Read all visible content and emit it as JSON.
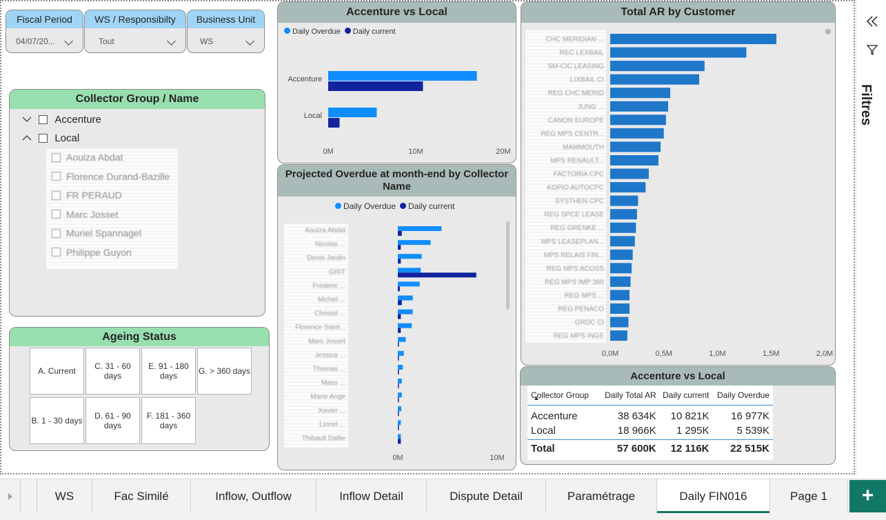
{
  "slicers": [
    {
      "title": "Fiscal Period",
      "value": "04/07/20..."
    },
    {
      "title": "WS / Responsibilty",
      "value": "Tout"
    },
    {
      "title": "Business Unit",
      "value": "WS"
    }
  ],
  "collector_group": {
    "title": "Collector Group / Name",
    "groups": [
      {
        "label": "Accenture",
        "expanded": false
      },
      {
        "label": "Local",
        "expanded": true
      }
    ],
    "children": [
      "Aouiza Abdat",
      "Florence Durand-Bazille",
      "FR PERAUD",
      "Marc Josset",
      "Muriel Spannagel",
      "Philippe Guyon"
    ]
  },
  "ageing_status": {
    "title": "Ageing Status",
    "items": [
      "A. Current",
      "C. 31 - 60 days",
      "E. 91 - 180 days",
      "G. > 360 days",
      "B. 1 - 30 days",
      "D. 61 - 90 days",
      "F. 181 - 360 days"
    ]
  },
  "accenture_vs_local_chart": {
    "title": "Accenture vs Local",
    "legend": [
      "Daily Overdue",
      "Daily current"
    ],
    "x_ticks": [
      "0M",
      "10M",
      "20M"
    ]
  },
  "projected_overdue_chart": {
    "title": "Projected Overdue at month-end by Collector Name",
    "legend": [
      "Daily Overdue",
      "Daily current"
    ],
    "x_ticks": [
      "0M",
      "10M"
    ],
    "names": [
      "Aouiza Abdat",
      "Nicolas ...",
      "Denis Jardin",
      "GRIT",
      "Frederic ...",
      "Michel ...",
      "Christel ...",
      "Florence Saint...",
      "Marc Josset",
      "Jessica ...",
      "Thomas ...",
      "Mass ...",
      "Marie Ange",
      "Xavier ...",
      "Lionel ...",
      "Thibault Dallie"
    ]
  },
  "total_ar_chart": {
    "title": "Total AR by Customer",
    "x_ticks": [
      "0,0M",
      "0,5M",
      "1,0M",
      "1,5M",
      "2,0M"
    ],
    "customers": [
      "CHC MERIDIAN ...",
      "REC LEXBAIL",
      "SM-CIC LEASING",
      "LIXBAIL CI",
      "REG CHC MERID",
      "JUNG ...",
      "CANON EUROPE",
      "REG MPS CENTR...",
      "MAMMOUTH",
      "MPS RENAULT...",
      "FACTORIA CPC",
      "KOPIO AUTOCPC",
      "SYSTHEN CPC",
      "REG SPCE LEASE",
      "REG GRENKE ...",
      "MPS LEASEPLAN...",
      "MPS RELAIS FIN...",
      "REG MPS ACOSS",
      "REG MPS IMP 360",
      "REG MPS ...",
      "REG PENACO",
      "GRDC CI",
      "REG MPS INGE"
    ]
  },
  "chart_data": [
    {
      "type": "bar",
      "title": "Accenture vs Local",
      "categories": [
        "Accenture",
        "Local"
      ],
      "series": [
        {
          "name": "Daily Overdue",
          "values": [
            16.977,
            5.539
          ]
        },
        {
          "name": "Daily current",
          "values": [
            10.821,
            1.295
          ]
        }
      ],
      "xlim": [
        0,
        20
      ],
      "unit": "M",
      "orientation": "horizontal",
      "colors": [
        "#118dff",
        "#12239e"
      ]
    },
    {
      "type": "bar",
      "title": "Projected Overdue at month-end by Collector Name",
      "orientation": "horizontal",
      "categories": [
        "Aouiza Abdat",
        "Nicolas ...",
        "Denis Jardin",
        "GRIT",
        "Frederic ...",
        "Michel ...",
        "Christel ...",
        "Florence Saint...",
        "Marc Josset",
        "Jessica ...",
        "Thomas ...",
        "Mass ...",
        "Marie Ange",
        "Xavier ...",
        "Lionel ...",
        "Thibault Dallie"
      ],
      "series": [
        {
          "name": "Daily Overdue",
          "values": [
            4.4,
            3.3,
            2.4,
            2.3,
            2.2,
            1.5,
            1.5,
            1.4,
            0.8,
            0.6,
            0.5,
            0.4,
            0.4,
            0.35,
            0.3,
            0.3
          ]
        },
        {
          "name": "Daily current",
          "values": [
            0.4,
            0.3,
            0.3,
            7.9,
            0.2,
            0.4,
            0.3,
            0.3,
            0.1,
            0.1,
            0.1,
            0.1,
            0.1,
            0.1,
            0.1,
            0.3
          ]
        }
      ],
      "xlim": [
        0,
        10
      ],
      "unit": "M",
      "colors": [
        "#118dff",
        "#12239e"
      ]
    },
    {
      "type": "bar",
      "title": "Total AR by Customer",
      "orientation": "horizontal",
      "categories": [
        "CHC MERIDIAN ...",
        "REC LEXBAIL",
        "SM-CIC LEASING",
        "LIXBAIL CI",
        "REG CHC MERID",
        "JUNG ...",
        "CANON EUROPE",
        "REG MPS CENTR...",
        "MAMMOUTH",
        "MPS RENAULT...",
        "FACTORIA CPC",
        "KOPIO AUTOCPC",
        "SYSTHEN CPC",
        "REG SPCE LEASE",
        "REG GRENKE ...",
        "MPS LEASEPLAN...",
        "MPS RELAIS FIN...",
        "REG MPS ACOSS",
        "REG MPS IMP 360",
        "REG MPS ...",
        "REG PENACO",
        "GRDC CI",
        "REG MPS INGE"
      ],
      "values": [
        1.55,
        1.27,
        0.88,
        0.83,
        0.56,
        0.54,
        0.52,
        0.5,
        0.47,
        0.45,
        0.36,
        0.33,
        0.26,
        0.25,
        0.24,
        0.23,
        0.21,
        0.2,
        0.19,
        0.18,
        0.18,
        0.17,
        0.16
      ],
      "xlim": [
        0,
        2.0
      ],
      "unit": "M",
      "colors": [
        "#1f77c9"
      ]
    }
  ],
  "matrix": {
    "title": "Accenture vs Local",
    "headers": [
      "Collector Group",
      "Daily Total AR",
      "Daily current",
      "Daily Overdue"
    ],
    "rows": [
      [
        "Accenture",
        "38 634K",
        "10 821K",
        "16 977K"
      ],
      [
        "Local",
        "18 966K",
        "1 295K",
        "5 539K"
      ]
    ],
    "total": [
      "Total",
      "57 600K",
      "12 116K",
      "22 515K"
    ]
  },
  "filters_pane": {
    "label": "Filtres"
  },
  "tabs": [
    "WS",
    "Fac Similé",
    "Inflow, Outflow",
    "Inflow Detail",
    "Dispute Detail",
    "Paramétrage",
    "Daily FIN016",
    "Page 1"
  ],
  "active_tab": "Daily FIN016",
  "add_page_label": "+"
}
